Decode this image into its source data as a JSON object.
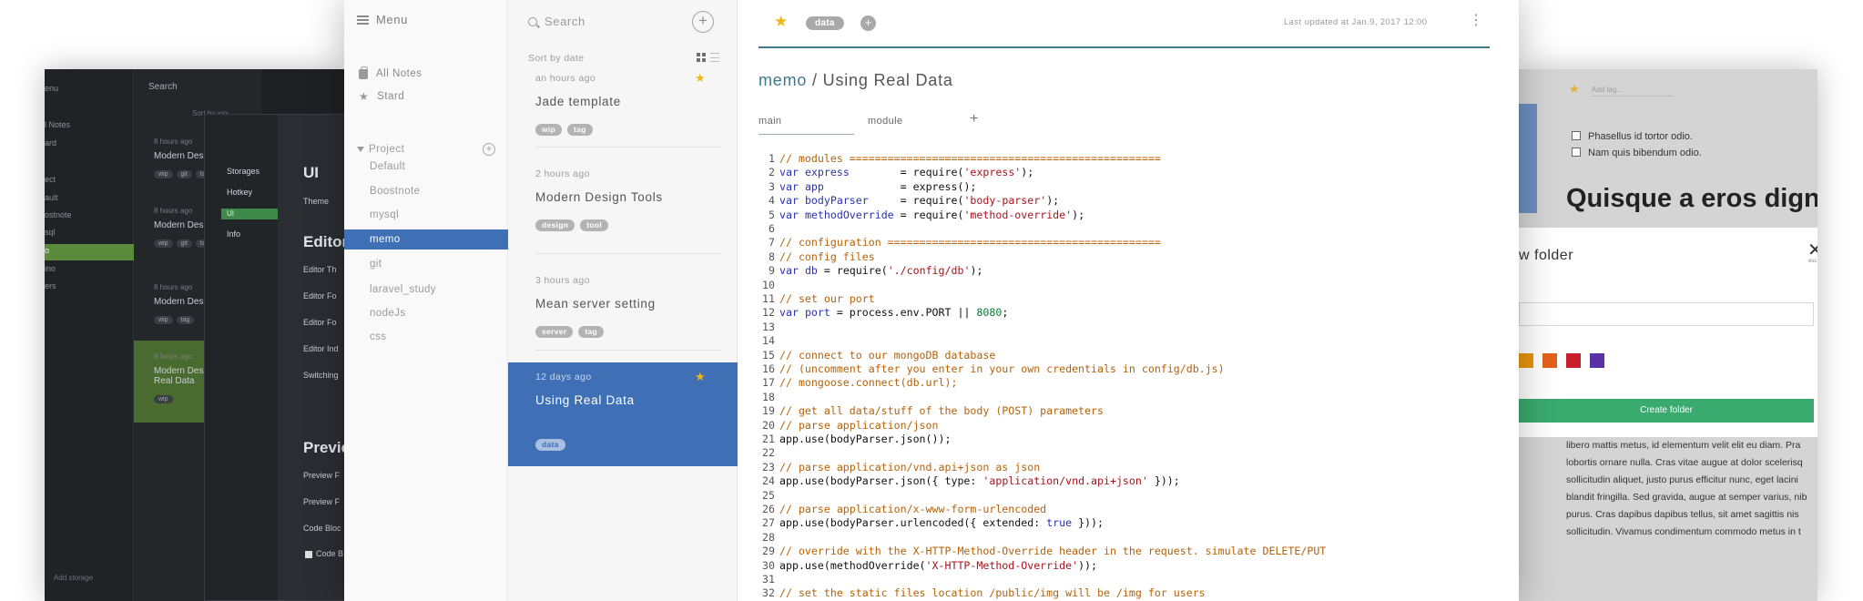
{
  "bg_left": {
    "menu": "enu",
    "search": "Search",
    "sort": "Sort by xxx",
    "items": [
      "l Notes",
      "ard",
      "ect",
      "ault",
      "ostnote",
      "sql",
      "o",
      "ino",
      "ers"
    ],
    "notes": [
      {
        "time": "8 hours ago",
        "title": "Modern Des",
        "tags": [
          "wip",
          "git",
          "tag"
        ]
      },
      {
        "time": "8 hours ago",
        "title": "Modern Des",
        "tags": [
          "wip",
          "git",
          "tag"
        ]
      },
      {
        "time": "8 hours ago",
        "title": "Modern Des",
        "tags": [
          "wip",
          "tag"
        ]
      },
      {
        "time": "8 hours ago",
        "title": "Modern Des Real Data",
        "tags": [
          "wip"
        ]
      }
    ],
    "add_storage": "Add storage",
    "settings_nav": [
      "Storages",
      "Hotkey",
      "UI",
      "Info"
    ],
    "section_ui": "UI",
    "theme": "Theme",
    "section_editor": "Editor",
    "editor_opts": [
      "Editor Th",
      "Editor Fo",
      "Editor Fo",
      "Editor Ind",
      "Switching"
    ],
    "section_preview": "Previe",
    "preview_opts": [
      "Preview F",
      "Preview F",
      "Code Bloc",
      "Code B"
    ]
  },
  "bg_right": {
    "add_tag": "Add tag...",
    "checks": [
      "Phasellus id tortor odio.",
      "Nam quis bibendum odio."
    ],
    "heading": "Quisque a eros dignissim",
    "modal_title": "w folder",
    "modal_close": "✕",
    "modal_esc": "esc",
    "swatch_colors": [
      "#e8940c",
      "#e4611c",
      "#c8202b",
      "#5a2fa8"
    ],
    "create_label": "Create folder",
    "body_lines": [
      "libero mattis metus, id elementum velit elit eu diam. Pra",
      "lobortis ornare nulla. Cras vitae augue at dolor scelerisq",
      "sollicitudin aliquet, justo purus efficitur nunc, eget lacini",
      "blandit fringilla. Sed gravida, augue at semper varius, nib",
      "purus. Cras dapibus dapibus tellus, sit amet sagittis nis",
      "sollicitudin. Vivamus condimentum commodo metus in t"
    ]
  },
  "sidebar": {
    "menu_label": "Menu",
    "all_notes": "All Notes",
    "starred": "Stard",
    "storage_name": "Project",
    "folders": [
      "Default",
      "Boostnote",
      "mysql",
      "memo",
      "git",
      "laravel_study",
      "nodeJs",
      "css"
    ],
    "active_folder": 3
  },
  "notelist": {
    "search_placeholder": "Search",
    "sort_label": "Sort by date",
    "notes": [
      {
        "time": "an hours ago",
        "title": "Jade template",
        "tags": [
          "wip",
          "tag"
        ],
        "starred": true
      },
      {
        "time": "2 hours ago",
        "title": "Modern Design Tools",
        "tags": [
          "design",
          "tool"
        ],
        "starred": false
      },
      {
        "time": "3 hours ago",
        "title": "Mean server setting",
        "tags": [
          "server",
          "tag"
        ],
        "starred": false
      },
      {
        "time": "12 days ago",
        "title": "Using Real Data",
        "tags": [
          "data"
        ],
        "starred": true
      }
    ],
    "active_note": 3
  },
  "editor": {
    "tag": "data",
    "updated_label": "Last updated at",
    "updated_value": "Jan.9, 2017 12:00",
    "folder": "memo",
    "separator": "/",
    "title": "Using Real Data",
    "tabs": [
      "main",
      "module"
    ],
    "code": [
      [
        [
          "cm",
          "// modules ================================================="
        ]
      ],
      [
        [
          "kw",
          "var"
        ],
        [
          "pl",
          " "
        ],
        [
          "kw",
          "express"
        ],
        [
          "pl",
          "        = require("
        ],
        [
          "st",
          "'express'"
        ],
        [
          "pl",
          ");"
        ]
      ],
      [
        [
          "kw",
          "var"
        ],
        [
          "pl",
          " "
        ],
        [
          "kw",
          "app"
        ],
        [
          "pl",
          "            = express();"
        ]
      ],
      [
        [
          "kw",
          "var"
        ],
        [
          "pl",
          " "
        ],
        [
          "kw",
          "bodyParser"
        ],
        [
          "pl",
          "     = require("
        ],
        [
          "st",
          "'body-parser'"
        ],
        [
          "pl",
          ");"
        ]
      ],
      [
        [
          "kw",
          "var"
        ],
        [
          "pl",
          " "
        ],
        [
          "kw",
          "methodOverride"
        ],
        [
          "pl",
          " = require("
        ],
        [
          "st",
          "'method-override'"
        ],
        [
          "pl",
          ");"
        ]
      ],
      [],
      [
        [
          "cm",
          "// configuration ==========================================="
        ]
      ],
      [
        [
          "cm",
          "// config files"
        ]
      ],
      [
        [
          "kw",
          "var"
        ],
        [
          "pl",
          " "
        ],
        [
          "kw",
          "db"
        ],
        [
          "pl",
          " = require("
        ],
        [
          "st",
          "'./config/db'"
        ],
        [
          "pl",
          ");"
        ]
      ],
      [],
      [
        [
          "cm",
          "// set our port"
        ]
      ],
      [
        [
          "kw",
          "var"
        ],
        [
          "pl",
          " "
        ],
        [
          "kw",
          "port"
        ],
        [
          "pl",
          " = process.env.PORT || "
        ],
        [
          "nm",
          "8080"
        ],
        [
          "pl",
          ";"
        ]
      ],
      [],
      [],
      [
        [
          "cm",
          "// connect to our mongoDB database"
        ]
      ],
      [
        [
          "cm",
          "// (uncomment after you enter in your own credentials in config/db.js)"
        ]
      ],
      [
        [
          "cm",
          "// mongoose.connect(db.url);"
        ]
      ],
      [],
      [
        [
          "cm",
          "// get all data/stuff of the body (POST) parameters"
        ]
      ],
      [
        [
          "cm",
          "// parse application/json"
        ]
      ],
      [
        [
          "pl",
          "app.use(bodyParser.json());"
        ]
      ],
      [],
      [
        [
          "cm",
          "// parse application/vnd.api+json as json"
        ]
      ],
      [
        [
          "pl",
          "app.use(bodyParser.json({ type: "
        ],
        [
          "st",
          "'application/vnd.api+json'"
        ],
        [
          "pl",
          " }));"
        ]
      ],
      [],
      [
        [
          "cm",
          "// parse application/x-www-form-urlencoded"
        ]
      ],
      [
        [
          "pl",
          "app.use(bodyParser.urlencoded({ extended: "
        ],
        [
          "kw",
          "true"
        ],
        [
          "pl",
          " }));"
        ]
      ],
      [],
      [
        [
          "cm",
          "// override with the X-HTTP-Method-Override header in the request. simulate DELETE/PUT"
        ]
      ],
      [
        [
          "pl",
          "app.use(methodOverride("
        ],
        [
          "st",
          "'X-HTTP-Method-Override'"
        ],
        [
          "pl",
          "));"
        ]
      ],
      [],
      [
        [
          "cm",
          "// set the static files location /public/img will be /img for users"
        ]
      ]
    ]
  }
}
